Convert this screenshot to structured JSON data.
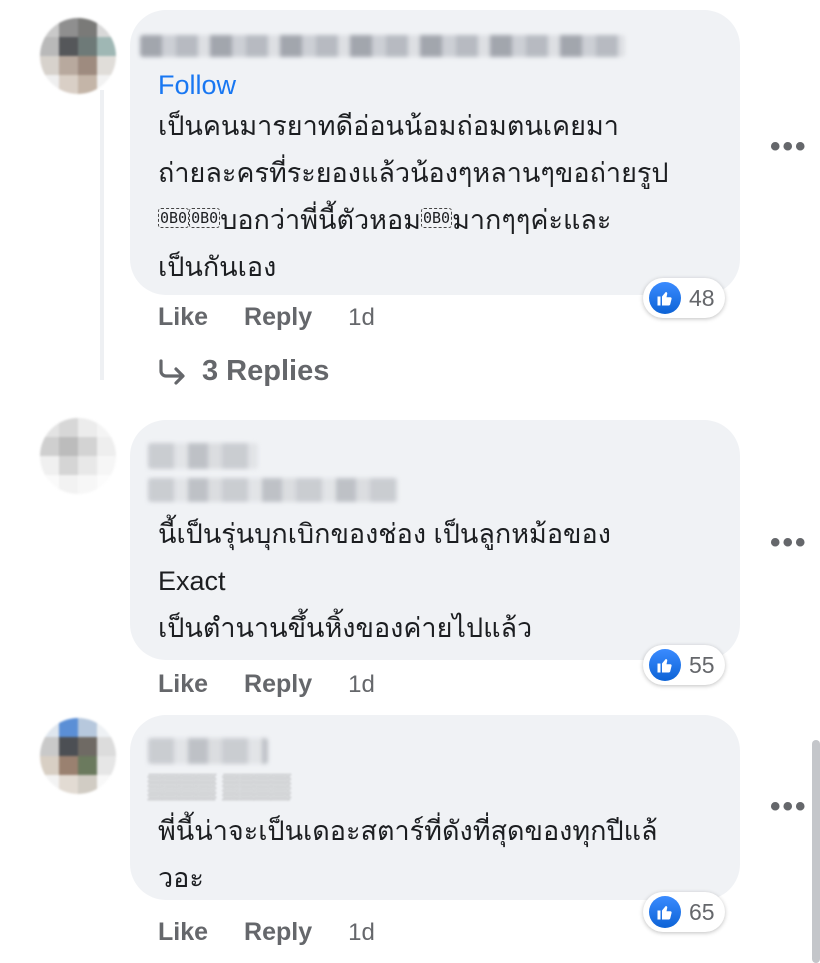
{
  "colors": {
    "link": "#1877f2",
    "muted": "#65676b",
    "bubble": "#f0f2f5",
    "like_badge": "#1877f2"
  },
  "comments": [
    {
      "follow": "Follow",
      "lines": [
        "เป็นคนมารยาทดีอ่อนน้อมถ่อมตนเคยมา",
        "ถ่ายละครที่ระยองแล้วน้องๆหลานๆขอถ่ายรูป",
        "บอกว่าพี่นี้ตัวหอม",
        "มากๆๆค่ะและ",
        "เป็นกันเอง"
      ],
      "emoji_tag": "0B0",
      "reaction_count": "48",
      "like": "Like",
      "reply": "Reply",
      "time": "1d",
      "replies_label": "3 Replies"
    },
    {
      "lines": [
        "นี้เป็นรุ่นบุกเบิกของช่อง เป็นลูกหม้อของ",
        "Exact",
        "เป็นตำนานขึ้นหิ้งของค่ายไปแล้ว"
      ],
      "reaction_count": "55",
      "like": "Like",
      "reply": "Reply",
      "time": "1d"
    },
    {
      "lines": [
        "พี่นี้น่าจะเป็นเดอะสตาร์ที่ดังที่สุดของทุกปีแล้",
        "วอะ"
      ],
      "reaction_count": "65",
      "like": "Like",
      "reply": "Reply",
      "time": "1d"
    }
  ],
  "more_icon": "more-horizontal-icon",
  "like_icon": "thumbs-up-icon",
  "reply_arrow_icon": "reply-arrow-icon"
}
